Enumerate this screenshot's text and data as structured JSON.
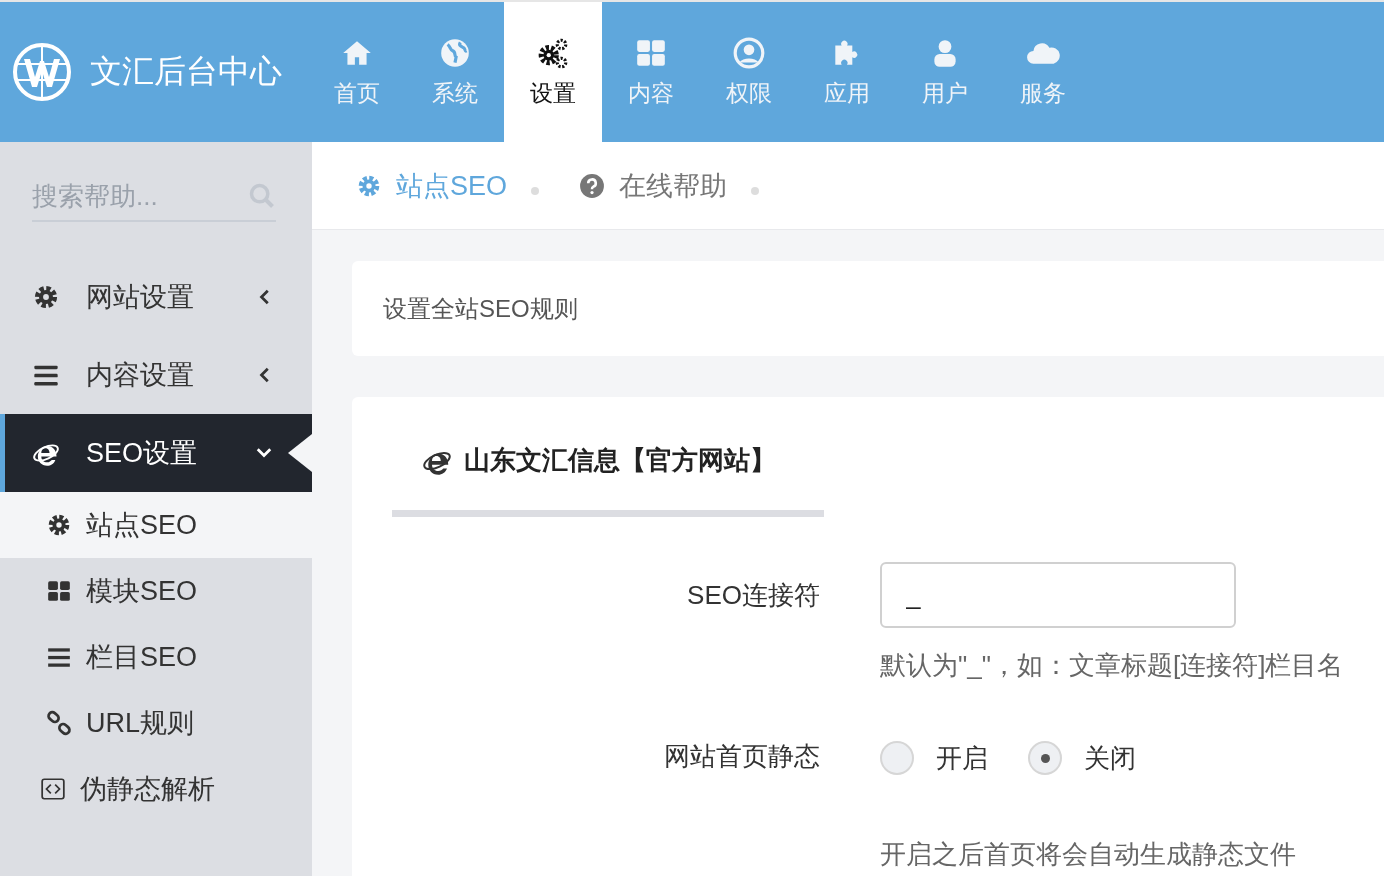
{
  "brand": {
    "title": "文汇后台中心"
  },
  "nav": [
    {
      "label": "首页",
      "selected": false
    },
    {
      "label": "系统",
      "selected": false
    },
    {
      "label": "设置",
      "selected": true
    },
    {
      "label": "内容",
      "selected": false
    },
    {
      "label": "权限",
      "selected": false
    },
    {
      "label": "应用",
      "selected": false
    },
    {
      "label": "用户",
      "selected": false
    },
    {
      "label": "服务",
      "selected": false
    }
  ],
  "sidebar": {
    "search": {
      "placeholder": "搜索帮助..."
    },
    "items": [
      {
        "label": "网站设置",
        "expanded": false,
        "selected": false
      },
      {
        "label": "内容设置",
        "expanded": false,
        "selected": false
      },
      {
        "label": "SEO设置",
        "expanded": true,
        "selected": true,
        "children": [
          {
            "label": "站点SEO",
            "selected": true
          },
          {
            "label": "模块SEO",
            "selected": false
          },
          {
            "label": "栏目SEO",
            "selected": false
          },
          {
            "label": "URL规则",
            "selected": false
          },
          {
            "label": "伪静态解析",
            "selected": false
          }
        ]
      }
    ]
  },
  "tabs": [
    {
      "label": "站点SEO",
      "selected": true
    },
    {
      "label": "在线帮助",
      "selected": false
    }
  ],
  "intro": "设置全站SEO规则",
  "form": {
    "title": "山东文汇信息【官方网站】",
    "fields": [
      {
        "kind": "input",
        "label": "SEO连接符",
        "value": "_",
        "hint": "默认为\"_\"，如：文章标题[连接符]栏目名"
      },
      {
        "kind": "radio",
        "label": "网站首页静态",
        "options": [
          {
            "label": "开启",
            "selected": false
          },
          {
            "label": "关闭",
            "selected": true
          }
        ],
        "hint": "开启之后首页将会自动生成静态文件"
      }
    ]
  }
}
